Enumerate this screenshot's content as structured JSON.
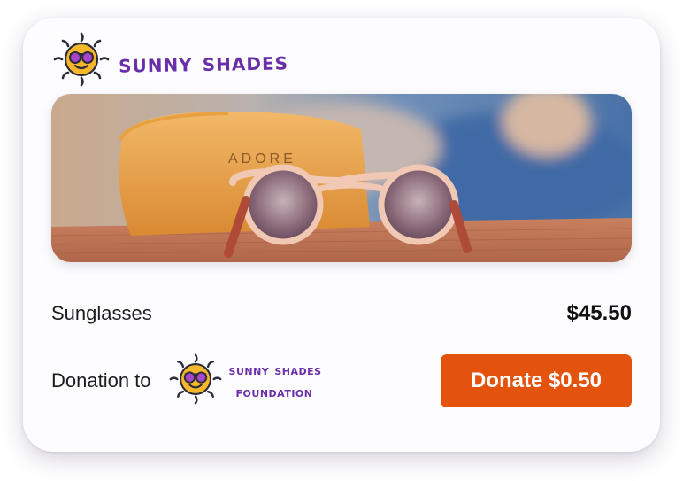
{
  "brand": {
    "name": "Sunny Shades",
    "logo_icon": "sun-with-sunglasses-icon",
    "color": "#6a2fa8"
  },
  "hero_image": {
    "description_icon": "sunglasses-on-case-photo"
  },
  "product": {
    "label": "Sunglasses",
    "price": "$45.50"
  },
  "donation": {
    "label": "Donation to",
    "foundation_line1": "Sunny Shades",
    "foundation_line2": "Foundation",
    "button_label": "Donate $0.50",
    "button_color": "#e4530e"
  }
}
